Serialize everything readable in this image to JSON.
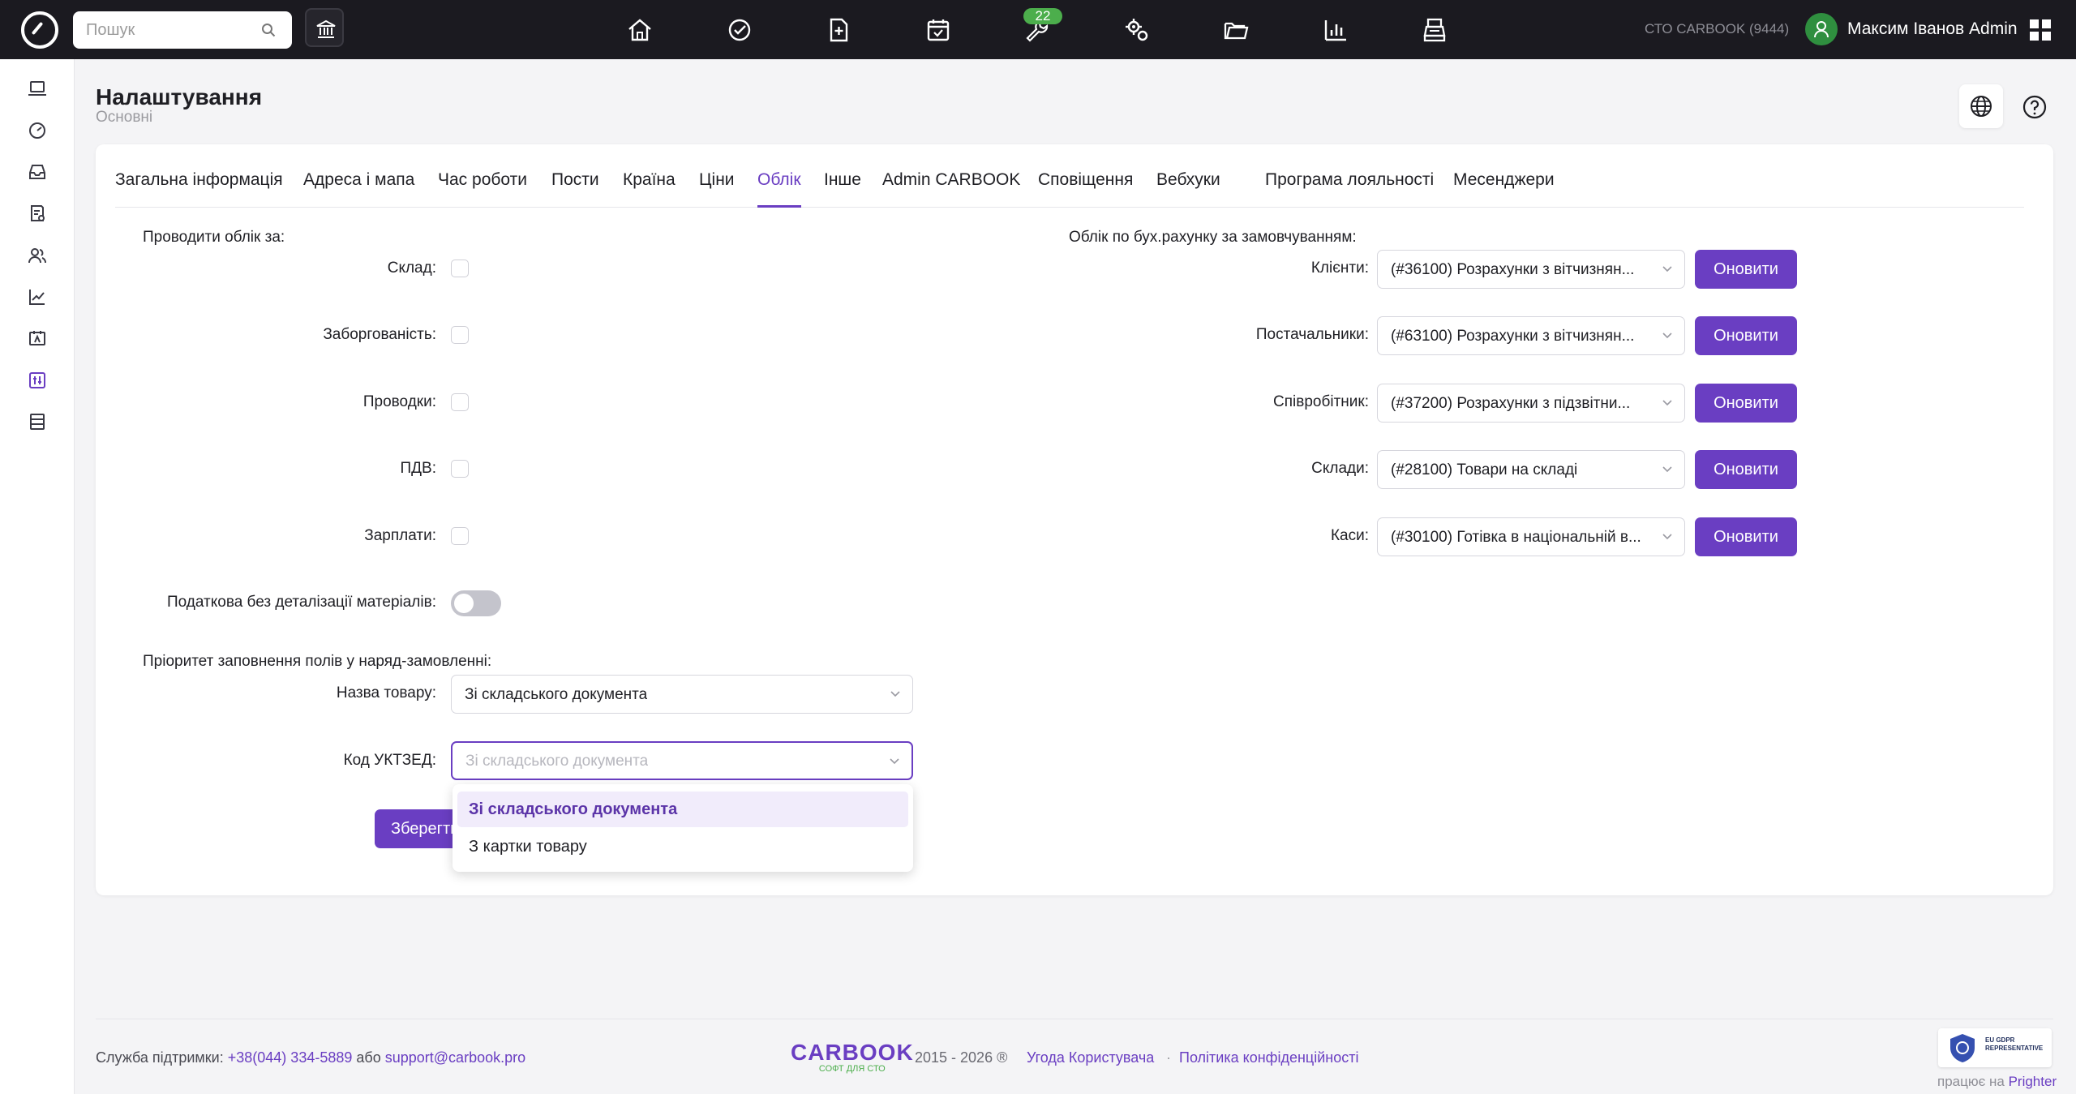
{
  "topbar": {
    "search_placeholder": "Пошук",
    "notification_badge": "22",
    "company": "СТО CARBOOK (9444)",
    "user_name": "Максим Іванов Admin"
  },
  "page": {
    "title": "Налаштування",
    "subtitle": "Основні"
  },
  "tabs": [
    {
      "label": "Загальна інформація"
    },
    {
      "label": "Адреса і мапа"
    },
    {
      "label": "Час роботи"
    },
    {
      "label": "Пости"
    },
    {
      "label": "Країна"
    },
    {
      "label": "Ціни"
    },
    {
      "label": "Облік",
      "active": true
    },
    {
      "label": "Інше"
    },
    {
      "label": "Admin CARBOOK"
    },
    {
      "label": "Сповіщення"
    },
    {
      "label": "Вебхуки"
    },
    {
      "label": "Програма лояльності"
    },
    {
      "label": "Месенджери"
    }
  ],
  "accounting_by": {
    "heading": "Проводити облік за:",
    "fields": [
      {
        "label": "Склад",
        "checked": false
      },
      {
        "label": "Заборгованість",
        "checked": false
      },
      {
        "label": "Проводки",
        "checked": false
      },
      {
        "label": "ПДВ",
        "checked": false
      },
      {
        "label": "Зарплати",
        "checked": false
      }
    ]
  },
  "tax_toggle": {
    "label": "Податкова без деталізації матеріалів",
    "on": false
  },
  "priority": {
    "heading": "Пріоритет заповнення полів у наряд-замовленні:",
    "product_name": {
      "label": "Назва товару",
      "value": "Зі складського документа"
    },
    "uktzed": {
      "label": "Код УКТЗЕД",
      "placeholder": "Зі складського документа"
    }
  },
  "dropdown_options": [
    "Зі складського документа",
    "З картки товару"
  ],
  "save_label": "Зберегти",
  "ledger": {
    "heading": "Облік по бух.рахунку за замовчуванням:",
    "button_label": "Оновити",
    "rows": [
      {
        "label": "Клієнти",
        "value": "(#36100) Розрахунки з вітчизнян..."
      },
      {
        "label": "Постачальники",
        "value": "(#63100) Розрахунки з вітчизнян..."
      },
      {
        "label": "Співробітник",
        "value": "(#37200) Розрахунки з підзвітни..."
      },
      {
        "label": "Склади",
        "value": "(#28100) Товари на складі"
      },
      {
        "label": "Каси",
        "value": "(#30100) Готівка в національній в..."
      }
    ]
  },
  "footer": {
    "support_label": "Служба підтримки:",
    "phone": "+38(044) 334-5889",
    "or": "або",
    "email": "support@carbook.pro",
    "brand": "CARBOOK",
    "brand_tagline": "СОФТ ДЛЯ СТО",
    "years": "2015 - 2026 ®",
    "user_agreement": "Угода Користувача",
    "separator": "·",
    "privacy": "Політика конфіденційності",
    "gdpr_line1": "EU GDPR",
    "gdpr_line2": "REPRESENTATIVE",
    "works_on": "працює на",
    "prighter": "Prighter"
  },
  "colors": {
    "accent": "#6a3ec2",
    "topbar": "#1b1a20",
    "badge": "#4cae4c"
  }
}
